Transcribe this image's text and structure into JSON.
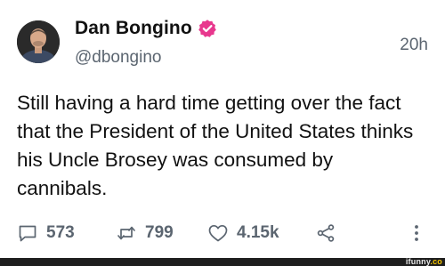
{
  "author": {
    "display_name": "Dan Bongino",
    "handle": "@dbongino",
    "verified": true,
    "verified_color": "#e8388e",
    "avatar_icon": "profile-photo"
  },
  "tweet": {
    "timestamp": "20h",
    "text": "Still having a hard time getting over the fact that the President of the United States thinks his Uncle Brosey was consumed by cannibals."
  },
  "actions": {
    "replies": {
      "icon": "reply-icon",
      "count": "573"
    },
    "retweets": {
      "icon": "retweet-icon",
      "count": "799"
    },
    "likes": {
      "icon": "heart-icon",
      "count": "4.15k"
    },
    "share": {
      "icon": "share-icon"
    },
    "more": {
      "icon": "more-vertical-icon"
    }
  },
  "watermark": {
    "text": "ifunny",
    "suffix": ".co"
  }
}
